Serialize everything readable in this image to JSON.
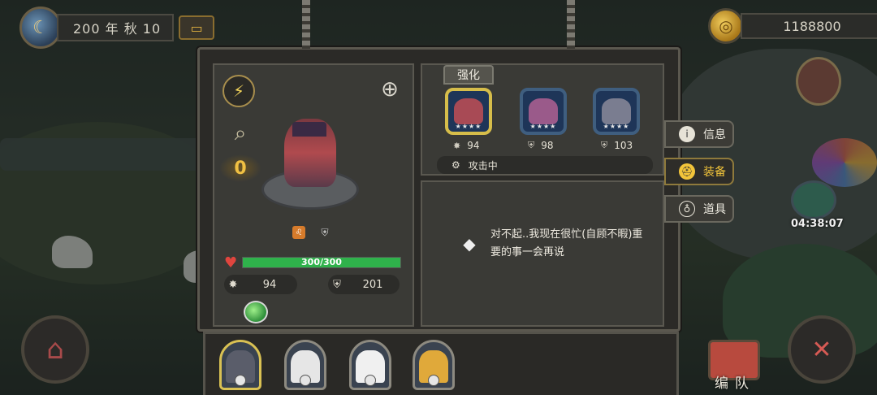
{
  "top_bar": {
    "date": "200 年 秋 10",
    "gold": "1188800",
    "season_icon": "moon-season-icon",
    "mail_icon": "chest-icon",
    "coin_icon": "coin-icon"
  },
  "hero_panel": {
    "rank": "0",
    "hp_text": "300/300",
    "hp_fraction": 1.0,
    "attack": "94",
    "defense": "201"
  },
  "equipment_panel": {
    "enhance_tab": "强化",
    "slots": [
      {
        "stat": "94",
        "stat_icon": "attack-icon",
        "selected": true
      },
      {
        "stat": "98",
        "stat_icon": "shield-icon",
        "selected": false
      },
      {
        "stat": "103",
        "stat_icon": "shield-icon",
        "selected": false
      }
    ],
    "status": "攻击中",
    "message": "对不起..我现在很忙(自顾不暇)重要的事一会再说"
  },
  "side_tabs": [
    {
      "label": "信息",
      "icon": "info-icon"
    },
    {
      "label": "装备",
      "icon": "equip-icon",
      "active": true
    },
    {
      "label": "道具",
      "icon": "item-bag-icon"
    }
  ],
  "timer": "04:38:07",
  "bottom": {
    "team_label": "编队"
  },
  "colors": {
    "hp": "#2fb24b",
    "active_tab": "#f2c43a",
    "selected_border": "#d6bd4a"
  }
}
